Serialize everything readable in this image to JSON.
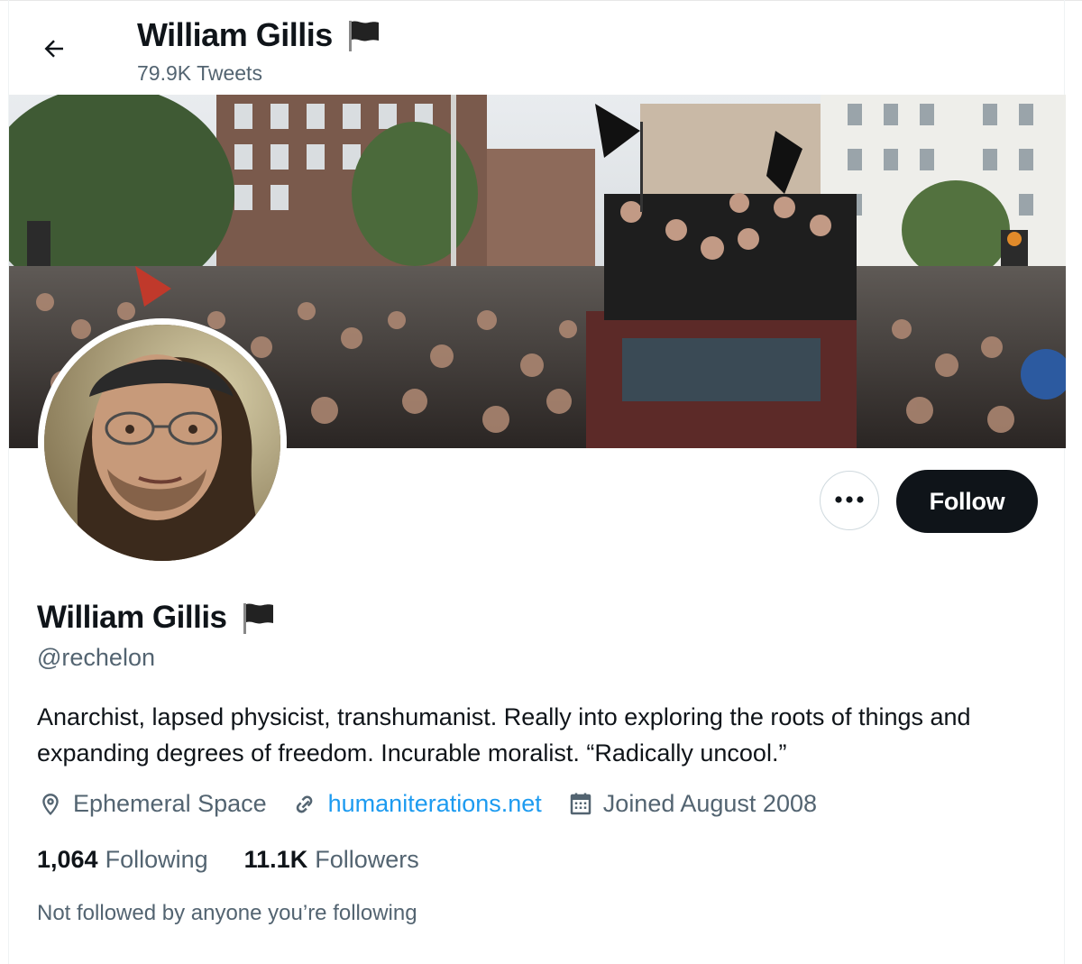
{
  "header": {
    "name": "William Gillis",
    "tweet_count": "79.9K Tweets",
    "back_icon": "arrow-left-icon",
    "flag_icon": "black-flag-icon"
  },
  "banner": {
    "image_description_icon": "banner-photo"
  },
  "avatar": {
    "icon": "profile-photo"
  },
  "actions": {
    "more_icon": "more-horizontal-icon",
    "follow_label": "Follow"
  },
  "profile": {
    "name": "William Gillis",
    "handle": "@rechelon",
    "bio": "Anarchist, lapsed physicist, transhumanist. Really into exploring the roots of things and expanding degrees of freedom. Incurable moralist. “Radically uncool.”",
    "location": "Ephemeral Space",
    "website": "humaniterations.net",
    "joined": "Joined August 2008",
    "following_count": "1,064",
    "following_label": "Following",
    "followers_count": "11.1K",
    "followers_label": "Followers",
    "followed_by": "Not followed by anyone you’re following"
  },
  "colors": {
    "text_primary": "#0f1419",
    "text_secondary": "#536471",
    "link": "#1d9bf0",
    "button_dark": "#0f1419",
    "border": "#cfd9de"
  }
}
